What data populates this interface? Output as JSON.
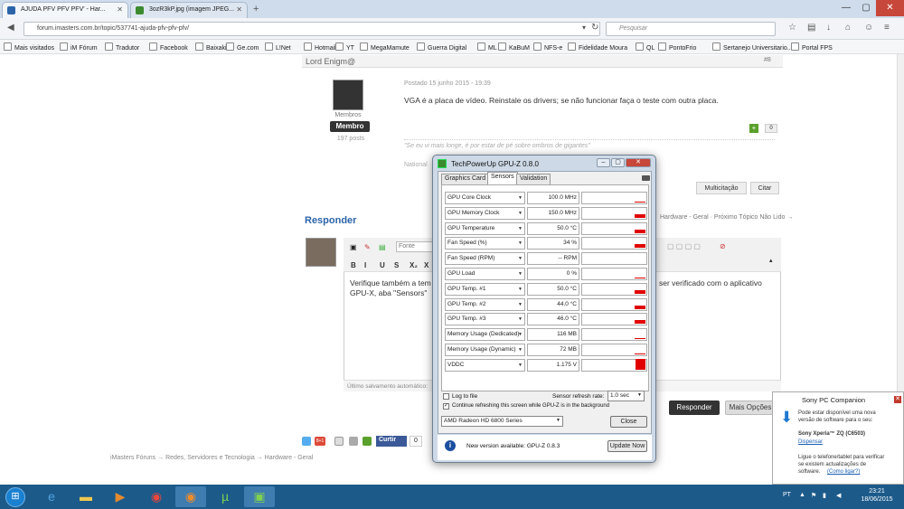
{
  "browser": {
    "tabs": [
      {
        "title": "AJUDA PFV PFV PFV' - Har..."
      },
      {
        "title": "3ozR3kP.jpg (imagem JPEG..."
      }
    ],
    "url": "forum.imasters.com.br/topic/537741-ajuda-pfv-pfv-pfv/",
    "search_placeholder": "Pesquisar",
    "bookmarks": [
      "Mais visitados",
      "iM Fórum",
      "Tradutor",
      "Facebook",
      "Baixaki",
      "Ge.com",
      "L!Net",
      "Hotmail",
      "YT",
      "MegaMamute",
      "Guerra Digital",
      "ML",
      "KaBuM",
      "NFS-e",
      "Fidelidade Moura",
      "QL",
      "PontoFrio",
      "Sertanejo Universitario...",
      "Portal FPS"
    ]
  },
  "post": {
    "author": "Lord Enigm@",
    "number": "#8",
    "group": "Membros",
    "badge": "Membro",
    "post_count": "197 posts",
    "date": "Postado 15 junho 2015 - 19:39",
    "text": "VGA é a placa de vídeo. Reinstale os drivers; se não funcionar faça o teste com outra placa.",
    "signature": "\"Se eu vi mais longe, é por estar de pé sobre ombros de gigantes\"",
    "location": "National",
    "reputation": "0",
    "plus": "+",
    "multiquote": "Multicitação",
    "quote": "Citar"
  },
  "reply": {
    "heading": "Responder",
    "nav": "Hardware - Geral · Próximo Tópico Não Lido →",
    "font_label": "Fonte",
    "format_buttons": [
      "B",
      "I",
      "U",
      "S",
      "X₂",
      "X"
    ],
    "text_line1": "Verifique também a tem",
    "text_line1b": "ser verificado com o aplicativo",
    "text_line2": "GPU-X, aba \"Sensors\"",
    "autosave": "Último salvamento automático:",
    "submit": "Responder",
    "more": "Mais Opções"
  },
  "share": {
    "curtir": "Curtir",
    "count": "0",
    "gplus": "8+1"
  },
  "footer_breadcrumb": "iMasters Fóruns → Redes, Servidores e Tecnologia → Hardware - Geral",
  "gpuz": {
    "title": "TechPowerUp GPU-Z 0.8.0",
    "tabs": [
      "Graphics Card",
      "Sensors",
      "Validation"
    ],
    "sensors": [
      {
        "label": "GPU Core Clock",
        "value": "100.0 MHz",
        "level": 0.12
      },
      {
        "label": "GPU Memory Clock",
        "value": "150.0 MHz",
        "level": 0.3
      },
      {
        "label": "GPU Temperature",
        "value": "50.0 °C",
        "level": 0.35
      },
      {
        "label": "Fan Speed (%)",
        "value": "34 %",
        "level": 0.3
      },
      {
        "label": "Fan Speed (RPM)",
        "value": "-- RPM",
        "level": 0
      },
      {
        "label": "GPU Load",
        "value": "0 %",
        "level": 0.05
      },
      {
        "label": "GPU Temp. #1",
        "value": "50.0 °C",
        "level": 0.3
      },
      {
        "label": "GPU Temp. #2",
        "value": "44.0 °C",
        "level": 0.3
      },
      {
        "label": "GPU Temp. #3",
        "value": "46.0 °C",
        "level": 0.3
      },
      {
        "label": "Memory Usage (Dedicated)",
        "value": "116 MB",
        "level": 0.08
      },
      {
        "label": "Memory Usage (Dynamic)",
        "value": "72 MB",
        "level": 0.08
      },
      {
        "label": "VDDC",
        "value": "1.175 V",
        "level": 1.0
      }
    ],
    "log_to_file": "Log to file",
    "refresh_label": "Sensor refresh rate:",
    "refresh_value": "1.0 sec",
    "continue_refresh": "Continue refreshing this screen while GPU-Z is in the background",
    "gpu_select": "AMD Radeon HD 6800 Series",
    "close": "Close",
    "update_text": "New version available: GPU-Z 0.8.3",
    "update_button": "Update Now",
    "bar_color": "#e00000"
  },
  "notification": {
    "title": "Sony PC Companion",
    "line1": "Pode estar disponível uma nova",
    "line2": "versão de software para o seu:",
    "device": "Sony Xperia™ ZQ (C6503)",
    "dismiss": "Dispensar",
    "line3": "Ligue o telefone/tablet para verificar",
    "line4": "se existem actualizações de",
    "line5_a": "software.",
    "line5_link": "(Como ligar?)"
  },
  "taskbar": {
    "lang": "PT",
    "time": "23:21",
    "date": "18/06/2015"
  }
}
